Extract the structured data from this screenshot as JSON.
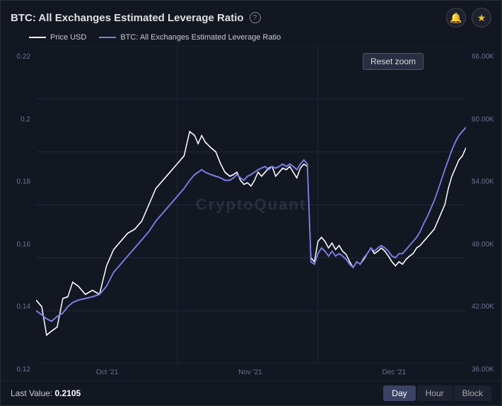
{
  "header": {
    "title": "BTC: All Exchanges Estimated Leverage Ratio",
    "question_label": "?",
    "bell_icon": "🔔",
    "star_icon": "★"
  },
  "legend": {
    "items": [
      {
        "label": "Price USD",
        "color": "white"
      },
      {
        "label": "BTC: All Exchanges Estimated Leverage Ratio",
        "color": "blue"
      }
    ]
  },
  "y_axis_left": [
    "0.22",
    "0.2",
    "0.18",
    "0.16",
    "0.14",
    "0.12"
  ],
  "y_axis_right": [
    "66.00K",
    "60.00K",
    "54.00K",
    "48.00K",
    "42.00K",
    "36.00K"
  ],
  "x_axis": [
    "Oct '21",
    "Nov '21",
    "Dec '21"
  ],
  "watermark": "CryptoQuant",
  "reset_zoom_label": "Reset zoom",
  "footer": {
    "last_value_label": "Last Value:",
    "last_value": "0.2105"
  },
  "time_buttons": [
    {
      "label": "Day",
      "active": true
    },
    {
      "label": "Hour",
      "active": false
    },
    {
      "label": "Block",
      "active": false
    }
  ]
}
